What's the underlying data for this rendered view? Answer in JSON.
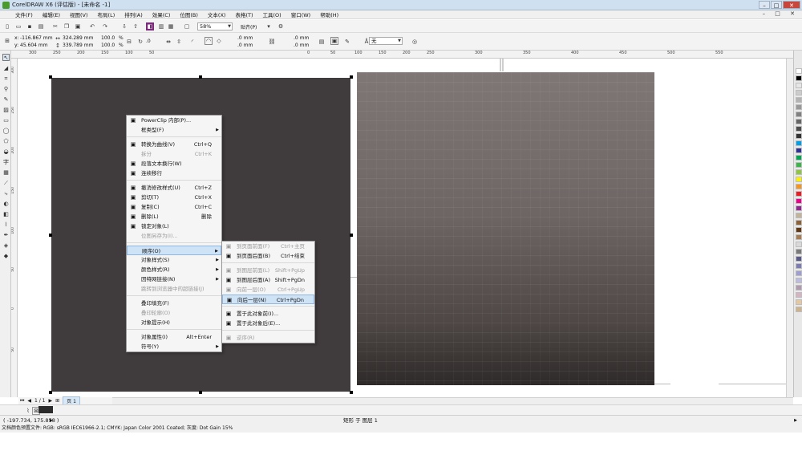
{
  "title": "CorelDRAW X6 (评估版) - [未命名 -1]",
  "menubar": [
    "文件(F)",
    "编辑(E)",
    "视图(V)",
    "布局(L)",
    "排列(A)",
    "效果(C)",
    "位图(B)",
    "文本(X)",
    "表格(T)",
    "工具(O)",
    "窗口(W)",
    "帮助(H)"
  ],
  "toolbar": {
    "zoom": "58%",
    "snap": "贴齐(P)",
    "x": "-116.867 mm",
    "y": "45.604 mm",
    "width": "324.289 mm",
    "height": "339.789 mm",
    "scale_x": "100.0",
    "scale_y": "100.0",
    "pct": "%",
    "rotate": ".0",
    "corner1": ".0 mm",
    "corner2": ".0 mm",
    "outline1": ".0 mm",
    "outline2": ".0 mm",
    "wrap": "无",
    "x_label": "x:",
    "y_label": "y:"
  },
  "ruler_h": [
    "300",
    "250",
    "200",
    "150",
    "100",
    "50",
    "0",
    "50",
    "100",
    "150",
    "200",
    "250",
    "300",
    "350",
    "400",
    "450",
    "500",
    "550"
  ],
  "ruler_v": [
    "300",
    "250",
    "200",
    "150",
    "100",
    "50",
    "0",
    "50"
  ],
  "context_menu": [
    {
      "label": "PowerClip 内部(P)...",
      "icon": "powerclip-icon",
      "shortcut": "",
      "sub": false,
      "disabled": false
    },
    {
      "label": "框类型(F)",
      "icon": "",
      "shortcut": "",
      "sub": true,
      "disabled": false
    },
    {
      "sep": true
    },
    {
      "label": "转换为曲线(V)",
      "icon": "curve-icon",
      "shortcut": "Ctrl+Q",
      "sub": false,
      "disabled": false
    },
    {
      "label": "拆分",
      "icon": "",
      "shortcut": "Ctrl+K",
      "sub": false,
      "disabled": true
    },
    {
      "label": "段落文本换行(W)",
      "icon": "wrap-icon",
      "shortcut": "",
      "sub": false,
      "disabled": false
    },
    {
      "label": "连续移行",
      "icon": "flow-icon",
      "shortcut": "",
      "sub": false,
      "disabled": false
    },
    {
      "sep": true
    },
    {
      "label": "撤消修改样式(U)",
      "icon": "undo-icon",
      "shortcut": "Ctrl+Z",
      "sub": false,
      "disabled": false
    },
    {
      "label": "剪切(T)",
      "icon": "cut-icon",
      "shortcut": "Ctrl+X",
      "sub": false,
      "disabled": false
    },
    {
      "label": "复制(C)",
      "icon": "copy-icon",
      "shortcut": "Ctrl+C",
      "sub": false,
      "disabled": false
    },
    {
      "label": "删除(L)",
      "icon": "delete-icon",
      "shortcut": "删除",
      "sub": false,
      "disabled": false
    },
    {
      "label": "锁定对象(L)",
      "icon": "lock-icon",
      "shortcut": "",
      "sub": false,
      "disabled": false
    },
    {
      "label": "位图另存为(I)...",
      "icon": "",
      "shortcut": "",
      "sub": false,
      "disabled": true
    },
    {
      "sep": true
    },
    {
      "label": "顺序(O)",
      "icon": "",
      "shortcut": "",
      "sub": true,
      "disabled": false,
      "highlight": true
    },
    {
      "label": "对象样式(S)",
      "icon": "",
      "shortcut": "",
      "sub": true,
      "disabled": false
    },
    {
      "label": "颜色样式(R)",
      "icon": "",
      "shortcut": "",
      "sub": true,
      "disabled": false
    },
    {
      "label": "因特网链接(N)",
      "icon": "",
      "shortcut": "",
      "sub": true,
      "disabled": false
    },
    {
      "label": "跳转到浏览器中的超链接(J)",
      "icon": "",
      "shortcut": "",
      "sub": false,
      "disabled": true
    },
    {
      "sep": true
    },
    {
      "label": "叠印填充(F)",
      "icon": "",
      "shortcut": "",
      "sub": false,
      "disabled": false
    },
    {
      "label": "叠印轮廓(O)",
      "icon": "",
      "shortcut": "",
      "sub": false,
      "disabled": true
    },
    {
      "label": "对象提示(H)",
      "icon": "",
      "shortcut": "",
      "sub": false,
      "disabled": false
    },
    {
      "sep": true
    },
    {
      "label": "对象属性(I)",
      "icon": "",
      "shortcut": "Alt+Enter",
      "sub": false,
      "disabled": false
    },
    {
      "label": "符号(Y)",
      "icon": "",
      "shortcut": "",
      "sub": true,
      "disabled": false
    }
  ],
  "submenu": [
    {
      "label": "到页面前面(F)",
      "icon": "front-page-icon",
      "shortcut": "Ctrl+主页",
      "disabled": true
    },
    {
      "label": "到页面后面(B)",
      "icon": "back-page-icon",
      "shortcut": "Ctrl+结束",
      "disabled": false
    },
    {
      "sep": true
    },
    {
      "label": "到图层前面(L)",
      "icon": "layer-front-icon",
      "shortcut": "Shift+PgUp",
      "disabled": true
    },
    {
      "label": "到图层后面(A)",
      "icon": "layer-back-icon",
      "shortcut": "Shift+PgDn",
      "disabled": false
    },
    {
      "label": "向前一层(O)",
      "icon": "forward-one-icon",
      "shortcut": "Ctrl+PgUp",
      "disabled": true
    },
    {
      "label": "向后一层(N)",
      "icon": "back-one-icon",
      "shortcut": "Ctrl+PgDn",
      "disabled": false,
      "highlight": true
    },
    {
      "sep": true
    },
    {
      "label": "置于此对象前(I)...",
      "icon": "in-front-of-icon",
      "shortcut": "",
      "disabled": false
    },
    {
      "label": "置于此对象后(E)...",
      "icon": "behind-icon",
      "shortcut": "",
      "disabled": false
    },
    {
      "sep": true
    },
    {
      "label": "逆序(R)",
      "icon": "reverse-icon",
      "shortcut": "",
      "disabled": true
    }
  ],
  "pagenav": {
    "pages": "1 / 1",
    "tab": "页 1"
  },
  "status": {
    "coords": "( -197.734, 175.858 )",
    "object": "矩形 于 图层 1",
    "color_profile": "文档颜色预置文件: RGB: sRGB IEC61966-2.1; CMYK: Japan Color 2001 Coated; 灰度: Dot Gain 15%"
  },
  "palette_colors": [
    "#ffffff",
    "#000000",
    "#e6e6e6",
    "#cccccc",
    "#b3b3b3",
    "#999999",
    "#808080",
    "#666666",
    "#4d4d4d",
    "#333333",
    "#00a0e9",
    "#2e3192",
    "#00a651",
    "#39b54a",
    "#8dc63f",
    "#fff200",
    "#f7941d",
    "#ed1c24",
    "#ec008c",
    "#92278f",
    "#c2b49a",
    "#8c6239",
    "#603813",
    "#a67c52",
    "#d9d9d9",
    "#7a7a7a",
    "#5a5a8a",
    "#7d7db3",
    "#9e9ed1",
    "#bcbce0",
    "#b09ab0",
    "#d6b3c2",
    "#e6c8a0",
    "#ccb38a"
  ]
}
